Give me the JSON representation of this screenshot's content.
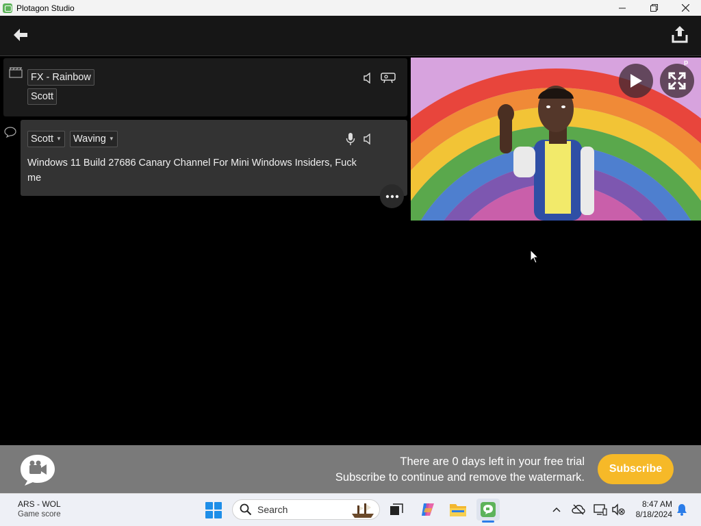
{
  "window": {
    "title": "Plotagon Studio"
  },
  "scene": {
    "location_label": "FX - Rainbow",
    "character_label": "Scott"
  },
  "dialogue": {
    "character": "Scott",
    "action": "Waving",
    "text": "Windows 11 Build 27686 Canary Channel For Mini Windows Insiders, Fuck me"
  },
  "banner": {
    "line1": "There are 0 days left in your free trial",
    "line2": "Subscribe to continue and remove the watermark.",
    "subscribe_label": "Subscribe"
  },
  "taskbar": {
    "widget_title": "ARS - WOL",
    "widget_sub": "Game score",
    "search_placeholder": "Search",
    "time": "8:47 AM",
    "date": "8/18/2024"
  },
  "colors": {
    "accent_subscribe": "#f6b928",
    "plotagon_green": "#5db35a"
  }
}
